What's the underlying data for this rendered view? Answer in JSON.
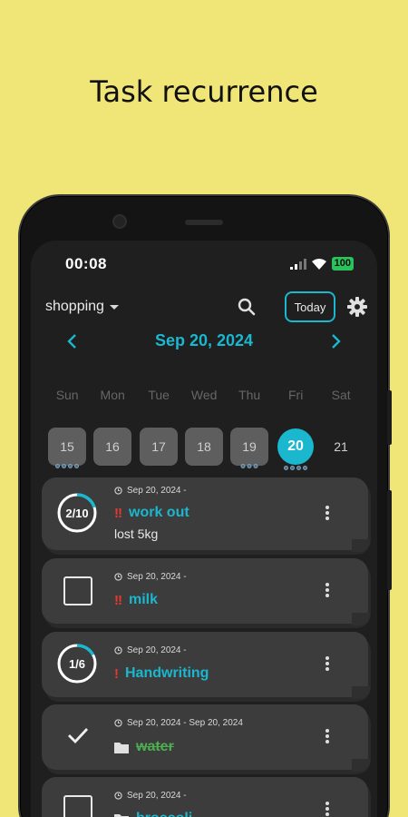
{
  "headline": "Task recurrence",
  "status": {
    "time": "00:08",
    "battery": "100"
  },
  "toolbar": {
    "list_name": "shopping",
    "today_label": "Today"
  },
  "calendar": {
    "month_title": "Sep 20, 2024",
    "weekdays": [
      "Sun",
      "Mon",
      "Tue",
      "Wed",
      "Thu",
      "Fri",
      "Sat"
    ],
    "days": [
      "15",
      "16",
      "17",
      "18",
      "19",
      "20",
      "21"
    ],
    "selected_day": "20"
  },
  "tasks": [
    {
      "date": "Sep 20, 2024 -",
      "title": "work out",
      "priority": "!!",
      "note": "lost 5kg",
      "progress": "2/10",
      "progress_fraction": 0.2,
      "kind": "ring"
    },
    {
      "date": "Sep 20, 2024 -",
      "title": "milk",
      "priority": "!!",
      "kind": "checkbox"
    },
    {
      "date": "Sep 20, 2024 -",
      "title": "Handwriting",
      "priority": "!",
      "progress": "1/6",
      "progress_fraction": 0.17,
      "kind": "ring"
    },
    {
      "date": "Sep 20, 2024 - Sep 20, 2024",
      "title": "water",
      "kind": "done"
    },
    {
      "date": "Sep 20, 2024 -",
      "title": "broccoli",
      "kind": "checkbox"
    }
  ],
  "colors": {
    "accent": "#1AB7CF",
    "done": "#4CAF50",
    "priority": "#E53935",
    "background": "#F0E677"
  }
}
